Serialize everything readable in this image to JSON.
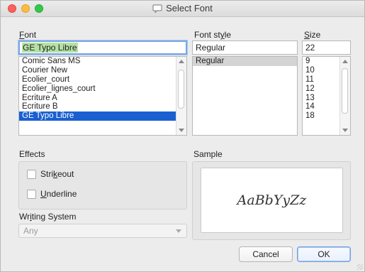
{
  "window": {
    "title": "Select Font"
  },
  "font": {
    "label": "Font",
    "label_mnemonic": "F",
    "label_rest": "ont",
    "current_value": "GE Typo Libre",
    "list": [
      "Comic Sans MS",
      "Courier New",
      "Ecolier_court",
      "Ecolier_lignes_court",
      "Ecriture A",
      "Ecriture B",
      "GE Typo Libre"
    ],
    "selected_index": 6
  },
  "font_style": {
    "label_pre": "Font st",
    "label_mnemonic": "y",
    "label_post": "le",
    "current_value": "Regular",
    "list": [
      "Regular"
    ],
    "selected_index": 0
  },
  "size": {
    "label_mnemonic": "S",
    "label_rest": "ize",
    "current_value": "22",
    "list": [
      "9",
      "10",
      "11",
      "12",
      "13",
      "14",
      "18"
    ]
  },
  "effects": {
    "label": "Effects",
    "strikeout_pre": "Stri",
    "strikeout_mnemonic": "k",
    "strikeout_post": "eout",
    "strikeout_checked": false,
    "underline_mnemonic": "U",
    "underline_rest": "nderline",
    "underline_checked": false
  },
  "writing_system": {
    "label_pre": "Wr",
    "label_mnemonic": "i",
    "label_post": "ting System",
    "value": "Any"
  },
  "sample": {
    "label": "Sample",
    "text": "AaBbYyZz"
  },
  "buttons": {
    "cancel": "Cancel",
    "ok": "OK"
  },
  "colors": {
    "selection": "#1a5fd1",
    "focus_ring": "#7aa7e4",
    "text_highlight": "#b6e2a4"
  }
}
